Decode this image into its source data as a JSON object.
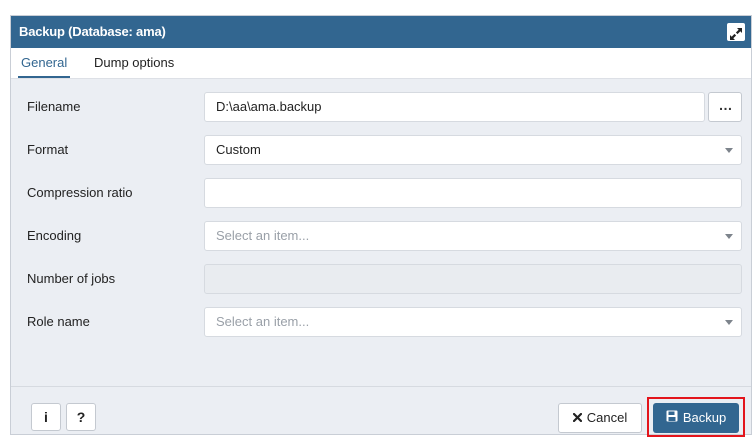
{
  "dialog": {
    "title": "Backup (Database: ama)"
  },
  "tabs": [
    {
      "label": "General",
      "active": true
    },
    {
      "label": "Dump options",
      "active": false
    }
  ],
  "fields": {
    "filename": {
      "label": "Filename",
      "value": "D:\\aa\\ama.backup",
      "browse_label": "…"
    },
    "format": {
      "label": "Format",
      "value": "Custom"
    },
    "compression": {
      "label": "Compression ratio",
      "value": ""
    },
    "encoding": {
      "label": "Encoding",
      "placeholder": "Select an item..."
    },
    "jobs": {
      "label": "Number of jobs",
      "value": ""
    },
    "role": {
      "label": "Role name",
      "placeholder": "Select an item..."
    }
  },
  "footer": {
    "info_label": "i",
    "help_label": "?",
    "cancel_label": "Cancel",
    "backup_label": "Backup"
  },
  "colors": {
    "titlebar": "#326690",
    "highlight": "#e3141b"
  },
  "icons": [
    "maximize-icon",
    "caret-down-icon",
    "close-icon",
    "save-icon"
  ]
}
